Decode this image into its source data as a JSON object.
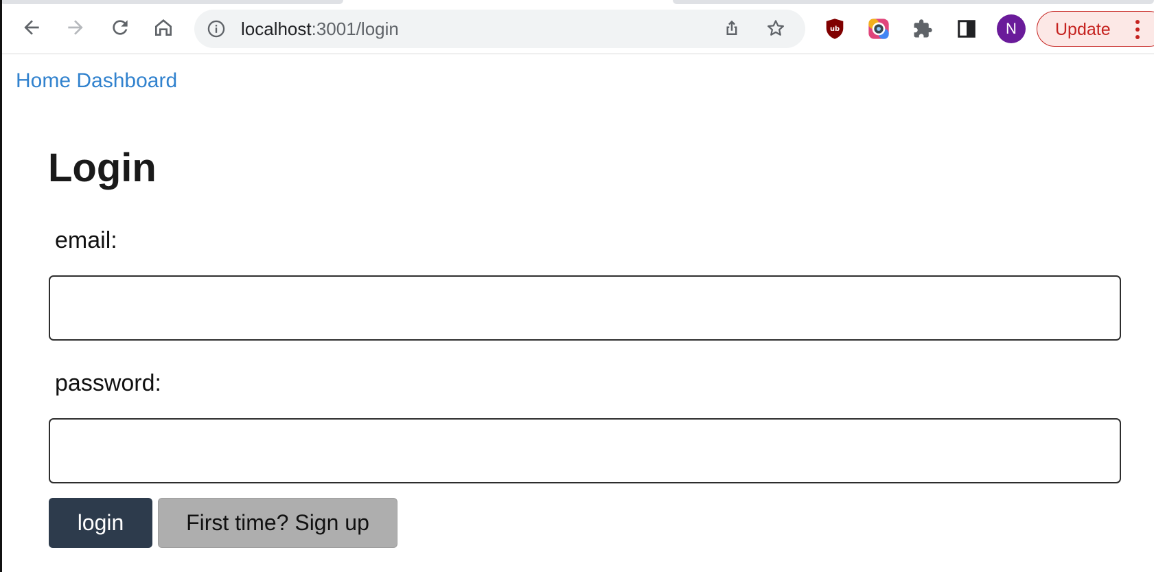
{
  "browser": {
    "address_bar": {
      "host": "localhost",
      "path": ":3001/login"
    },
    "profile_initial": "N",
    "update_label": "Update",
    "colors": {
      "avatar": "#6a1b9a",
      "update": "#c5221f"
    },
    "icons": [
      "back-arrow-icon",
      "forward-arrow-icon",
      "reload-icon",
      "home-icon",
      "site-info-icon",
      "share-icon",
      "bookmark-star-icon",
      "ublock-origin-icon",
      "color-extension-icon",
      "extensions-puzzle-icon",
      "side-panel-icon",
      "kebab-menu-icon"
    ]
  },
  "nav": {
    "links": [
      {
        "label": "Home"
      },
      {
        "label": "Dashboard"
      }
    ],
    "link_color": "#3182ce"
  },
  "page": {
    "title": "Login",
    "fields": {
      "email": {
        "label": "email:",
        "value": ""
      },
      "password": {
        "label": "password:",
        "value": ""
      }
    },
    "buttons": {
      "login": "login",
      "signup": "First time? Sign up"
    },
    "colors": {
      "login_button": "#2d3b4c",
      "signup_button": "#aeaeae"
    }
  }
}
